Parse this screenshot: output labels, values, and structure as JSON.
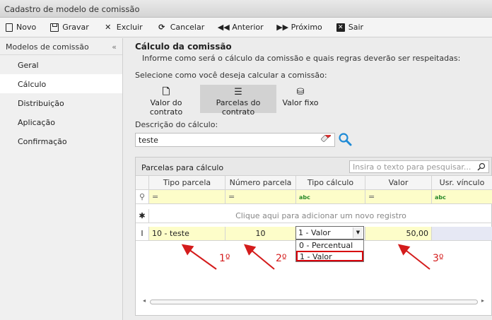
{
  "window": {
    "title": "Cadastro de modelo de comissão"
  },
  "toolbar": {
    "novo": "Novo",
    "gravar": "Gravar",
    "excluir": "Excluir",
    "cancelar": "Cancelar",
    "anterior": "Anterior",
    "proximo": "Próximo",
    "sair": "Sair"
  },
  "sidebar": {
    "header": "Modelos de comissão",
    "collapse_glyph": "«",
    "items": [
      {
        "label": "Geral"
      },
      {
        "label": "Cálculo",
        "active": true
      },
      {
        "label": "Distribuição"
      },
      {
        "label": "Aplicação"
      },
      {
        "label": "Confirmação"
      }
    ]
  },
  "main": {
    "title": "Cálculo da comissão",
    "subtitle": "Informe como será o cálculo da comissão e quais regras deverão ser respeitadas:",
    "select_label": "Selecione como você deseja calcular a comissão:",
    "calc_options": [
      {
        "label": "Valor do contrato",
        "icon": "document-icon",
        "selected": false
      },
      {
        "label": "Parcelas do contrato",
        "icon": "list-icon",
        "selected": true
      },
      {
        "label": "Valor fixo",
        "icon": "coins-icon",
        "selected": false
      }
    ],
    "description_label": "Descrição do cálculo:",
    "description_value": "teste"
  },
  "grid": {
    "panel_title": "Parcelas para cálculo",
    "search_placeholder": "Insira o texto para pesquisar...",
    "columns": [
      "Tipo parcela",
      "Número parcela",
      "Tipo cálculo",
      "Valor",
      "Usr. vínculo"
    ],
    "filter_symbols": [
      "=",
      "=",
      "abc",
      "=",
      "abc"
    ],
    "new_row_text": "Clique aqui para adicionar um novo registro",
    "rows": [
      {
        "tipo_parcela": "10 - teste",
        "numero_parcela": "10",
        "tipo_calculo": "1 - Valor",
        "valor": "50,00",
        "usr_vinculo": ""
      }
    ],
    "dropdown_options": [
      "0 - Percentual",
      "1 - Valor"
    ],
    "dropdown_selected": "1 - Valor"
  },
  "annotations": {
    "labels": [
      "1º",
      "2º",
      "3º"
    ],
    "color": "#d41c1c"
  },
  "colors": {
    "filter_row_bg": "#fdfdc9",
    "highlight_border": "#d8000a",
    "search_icon": "#1f8bd6"
  }
}
